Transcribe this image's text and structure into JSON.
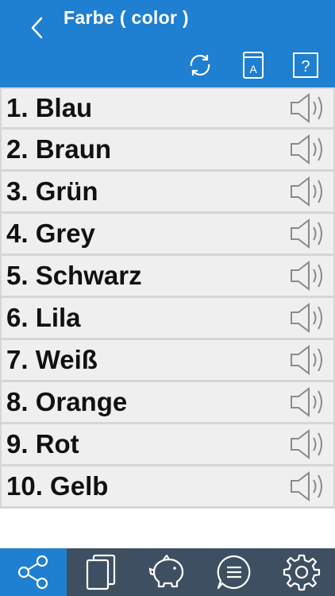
{
  "header": {
    "title": "Farbe ( color )",
    "back_icon": "chevron-left-icon",
    "tools": [
      "refresh-icon",
      "dictionary-icon",
      "help-icon"
    ],
    "background_color": "#1f7fd0"
  },
  "items": [
    {
      "label": "1. Blau"
    },
    {
      "label": "2. Braun"
    },
    {
      "label": "3. Grün"
    },
    {
      "label": "4. Grey"
    },
    {
      "label": "5. Schwarz"
    },
    {
      "label": "6. Lila"
    },
    {
      "label": "7. Weiß"
    },
    {
      "label": "8. Orange"
    },
    {
      "label": "9. Rot"
    },
    {
      "label": "10. Gelb"
    }
  ],
  "dict_icon_letter": "A",
  "help_icon_symbol": "?",
  "tabbar": {
    "tabs": [
      "share-icon",
      "cards-icon",
      "piggy-bank-icon",
      "chat-icon",
      "settings-icon"
    ],
    "active_tab": "share-icon",
    "active_color": "#1f7fd0",
    "background_color": "#3e4f62"
  }
}
